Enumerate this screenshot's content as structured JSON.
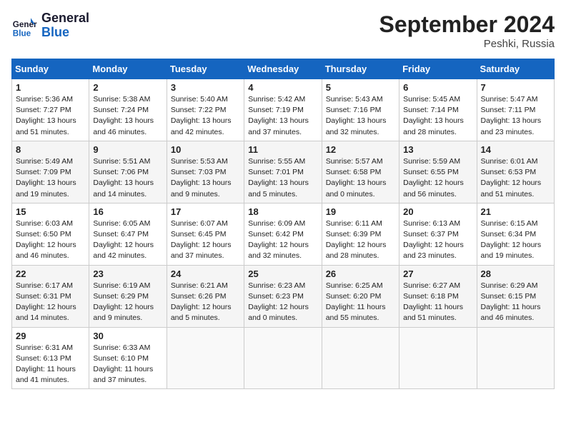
{
  "header": {
    "logo_line1": "General",
    "logo_line2": "Blue",
    "month_title": "September 2024",
    "location": "Peshki, Russia"
  },
  "weekdays": [
    "Sunday",
    "Monday",
    "Tuesday",
    "Wednesday",
    "Thursday",
    "Friday",
    "Saturday"
  ],
  "weeks": [
    [
      {
        "day": "1",
        "info": "Sunrise: 5:36 AM\nSunset: 7:27 PM\nDaylight: 13 hours\nand 51 minutes."
      },
      {
        "day": "2",
        "info": "Sunrise: 5:38 AM\nSunset: 7:24 PM\nDaylight: 13 hours\nand 46 minutes."
      },
      {
        "day": "3",
        "info": "Sunrise: 5:40 AM\nSunset: 7:22 PM\nDaylight: 13 hours\nand 42 minutes."
      },
      {
        "day": "4",
        "info": "Sunrise: 5:42 AM\nSunset: 7:19 PM\nDaylight: 13 hours\nand 37 minutes."
      },
      {
        "day": "5",
        "info": "Sunrise: 5:43 AM\nSunset: 7:16 PM\nDaylight: 13 hours\nand 32 minutes."
      },
      {
        "day": "6",
        "info": "Sunrise: 5:45 AM\nSunset: 7:14 PM\nDaylight: 13 hours\nand 28 minutes."
      },
      {
        "day": "7",
        "info": "Sunrise: 5:47 AM\nSunset: 7:11 PM\nDaylight: 13 hours\nand 23 minutes."
      }
    ],
    [
      {
        "day": "8",
        "info": "Sunrise: 5:49 AM\nSunset: 7:09 PM\nDaylight: 13 hours\nand 19 minutes."
      },
      {
        "day": "9",
        "info": "Sunrise: 5:51 AM\nSunset: 7:06 PM\nDaylight: 13 hours\nand 14 minutes."
      },
      {
        "day": "10",
        "info": "Sunrise: 5:53 AM\nSunset: 7:03 PM\nDaylight: 13 hours\nand 9 minutes."
      },
      {
        "day": "11",
        "info": "Sunrise: 5:55 AM\nSunset: 7:01 PM\nDaylight: 13 hours\nand 5 minutes."
      },
      {
        "day": "12",
        "info": "Sunrise: 5:57 AM\nSunset: 6:58 PM\nDaylight: 13 hours\nand 0 minutes."
      },
      {
        "day": "13",
        "info": "Sunrise: 5:59 AM\nSunset: 6:55 PM\nDaylight: 12 hours\nand 56 minutes."
      },
      {
        "day": "14",
        "info": "Sunrise: 6:01 AM\nSunset: 6:53 PM\nDaylight: 12 hours\nand 51 minutes."
      }
    ],
    [
      {
        "day": "15",
        "info": "Sunrise: 6:03 AM\nSunset: 6:50 PM\nDaylight: 12 hours\nand 46 minutes."
      },
      {
        "day": "16",
        "info": "Sunrise: 6:05 AM\nSunset: 6:47 PM\nDaylight: 12 hours\nand 42 minutes."
      },
      {
        "day": "17",
        "info": "Sunrise: 6:07 AM\nSunset: 6:45 PM\nDaylight: 12 hours\nand 37 minutes."
      },
      {
        "day": "18",
        "info": "Sunrise: 6:09 AM\nSunset: 6:42 PM\nDaylight: 12 hours\nand 32 minutes."
      },
      {
        "day": "19",
        "info": "Sunrise: 6:11 AM\nSunset: 6:39 PM\nDaylight: 12 hours\nand 28 minutes."
      },
      {
        "day": "20",
        "info": "Sunrise: 6:13 AM\nSunset: 6:37 PM\nDaylight: 12 hours\nand 23 minutes."
      },
      {
        "day": "21",
        "info": "Sunrise: 6:15 AM\nSunset: 6:34 PM\nDaylight: 12 hours\nand 19 minutes."
      }
    ],
    [
      {
        "day": "22",
        "info": "Sunrise: 6:17 AM\nSunset: 6:31 PM\nDaylight: 12 hours\nand 14 minutes."
      },
      {
        "day": "23",
        "info": "Sunrise: 6:19 AM\nSunset: 6:29 PM\nDaylight: 12 hours\nand 9 minutes."
      },
      {
        "day": "24",
        "info": "Sunrise: 6:21 AM\nSunset: 6:26 PM\nDaylight: 12 hours\nand 5 minutes."
      },
      {
        "day": "25",
        "info": "Sunrise: 6:23 AM\nSunset: 6:23 PM\nDaylight: 12 hours\nand 0 minutes."
      },
      {
        "day": "26",
        "info": "Sunrise: 6:25 AM\nSunset: 6:20 PM\nDaylight: 11 hours\nand 55 minutes."
      },
      {
        "day": "27",
        "info": "Sunrise: 6:27 AM\nSunset: 6:18 PM\nDaylight: 11 hours\nand 51 minutes."
      },
      {
        "day": "28",
        "info": "Sunrise: 6:29 AM\nSunset: 6:15 PM\nDaylight: 11 hours\nand 46 minutes."
      }
    ],
    [
      {
        "day": "29",
        "info": "Sunrise: 6:31 AM\nSunset: 6:13 PM\nDaylight: 11 hours\nand 41 minutes."
      },
      {
        "day": "30",
        "info": "Sunrise: 6:33 AM\nSunset: 6:10 PM\nDaylight: 11 hours\nand 37 minutes."
      },
      {
        "day": "",
        "info": ""
      },
      {
        "day": "",
        "info": ""
      },
      {
        "day": "",
        "info": ""
      },
      {
        "day": "",
        "info": ""
      },
      {
        "day": "",
        "info": ""
      }
    ]
  ]
}
